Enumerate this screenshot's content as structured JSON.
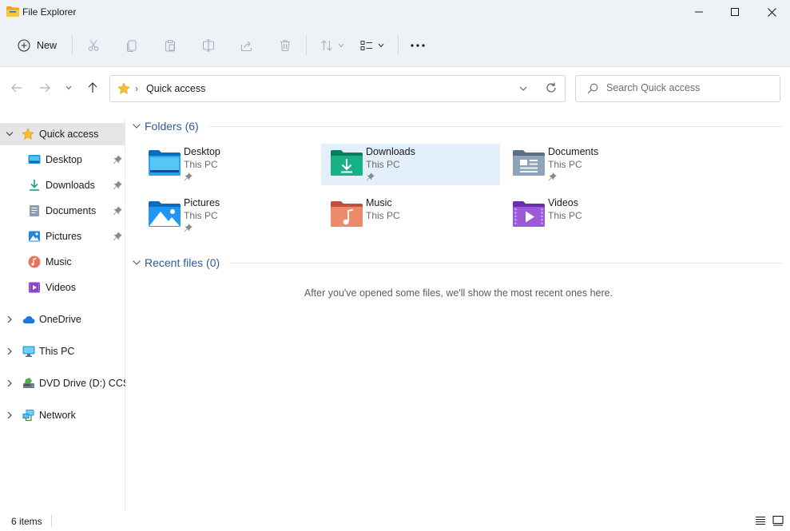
{
  "window": {
    "title": "File Explorer"
  },
  "toolbar": {
    "new_label": "New"
  },
  "address": {
    "location": "Quick access"
  },
  "search": {
    "placeholder": "Search Quick access"
  },
  "sidebar": {
    "items": [
      {
        "label": "Quick access"
      },
      {
        "label": "Desktop"
      },
      {
        "label": "Downloads"
      },
      {
        "label": "Documents"
      },
      {
        "label": "Pictures"
      },
      {
        "label": "Music"
      },
      {
        "label": "Videos"
      },
      {
        "label": "OneDrive"
      },
      {
        "label": "This PC"
      },
      {
        "label": "DVD Drive (D:) CCSA"
      },
      {
        "label": "Network"
      }
    ]
  },
  "main": {
    "folders_header": "Folders (6)",
    "folders": [
      {
        "name": "Desktop",
        "location": "This PC",
        "pinned": true
      },
      {
        "name": "Downloads",
        "location": "This PC",
        "pinned": true
      },
      {
        "name": "Documents",
        "location": "This PC",
        "pinned": true
      },
      {
        "name": "Pictures",
        "location": "This PC",
        "pinned": true
      },
      {
        "name": "Music",
        "location": "This PC",
        "pinned": false
      },
      {
        "name": "Videos",
        "location": "This PC",
        "pinned": false
      }
    ],
    "recent_header": "Recent files (0)",
    "recent_empty_message": "After you've opened some files, we'll show the most recent ones here."
  },
  "status": {
    "item_count": "6 items"
  },
  "colors": {
    "chrome": "#eef2f7",
    "selection": "#e3f0fb",
    "section_title": "#2e5b95",
    "sidebar_selected": "#e5e5e5"
  }
}
